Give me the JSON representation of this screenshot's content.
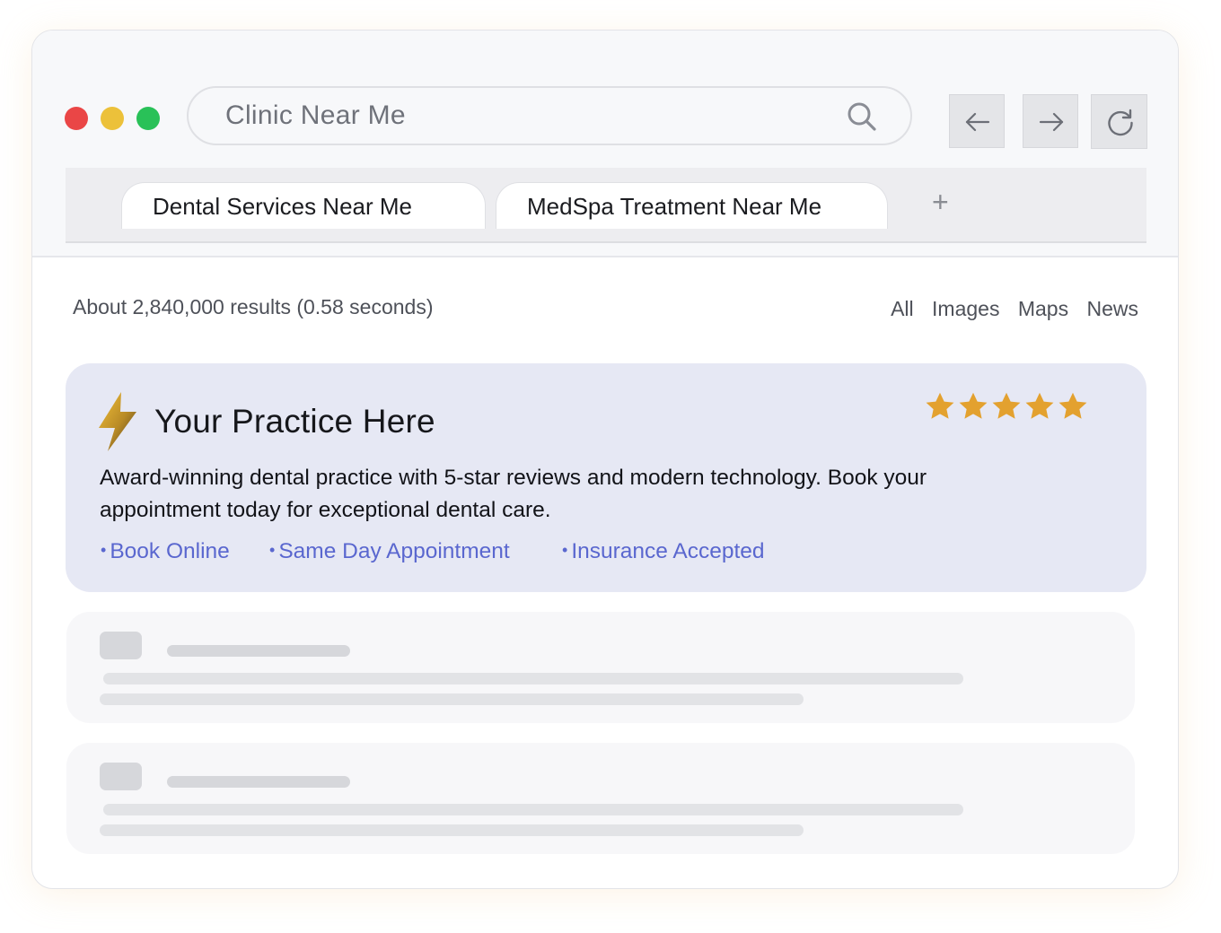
{
  "browser": {
    "window_controls": [
      "close",
      "minimize",
      "maximize"
    ],
    "search": {
      "value": "Clinic Near Me",
      "icon": "search-icon"
    },
    "nav": {
      "back_icon": "arrow-left-icon",
      "forward_icon": "arrow-right-icon",
      "reload_icon": "reload-icon"
    },
    "tabs": [
      {
        "label": "Dental Services Near Me"
      },
      {
        "label": "MedSpa Treatment Near Me"
      }
    ],
    "new_tab_label": "+"
  },
  "results": {
    "stats": "About 2,840,000 results (0.58 seconds)",
    "filters": [
      "All",
      "Images",
      "Maps",
      "News"
    ]
  },
  "featured": {
    "icon": "lightning-bolt-icon",
    "title": "Your Practice Here",
    "rating": 5,
    "description": "Award-winning dental practice with 5-star reviews and modern technology. Book your appointment today for exceptional dental care.",
    "links": [
      "Book Online",
      "Same Day Appointment",
      "Insurance Accepted"
    ],
    "colors": {
      "card_bg": "#e6e8f4",
      "star": "#e3a12f",
      "link": "#5a67cf"
    }
  },
  "placeholders": [
    {
      "type": "skeleton-result"
    },
    {
      "type": "skeleton-result"
    }
  ]
}
